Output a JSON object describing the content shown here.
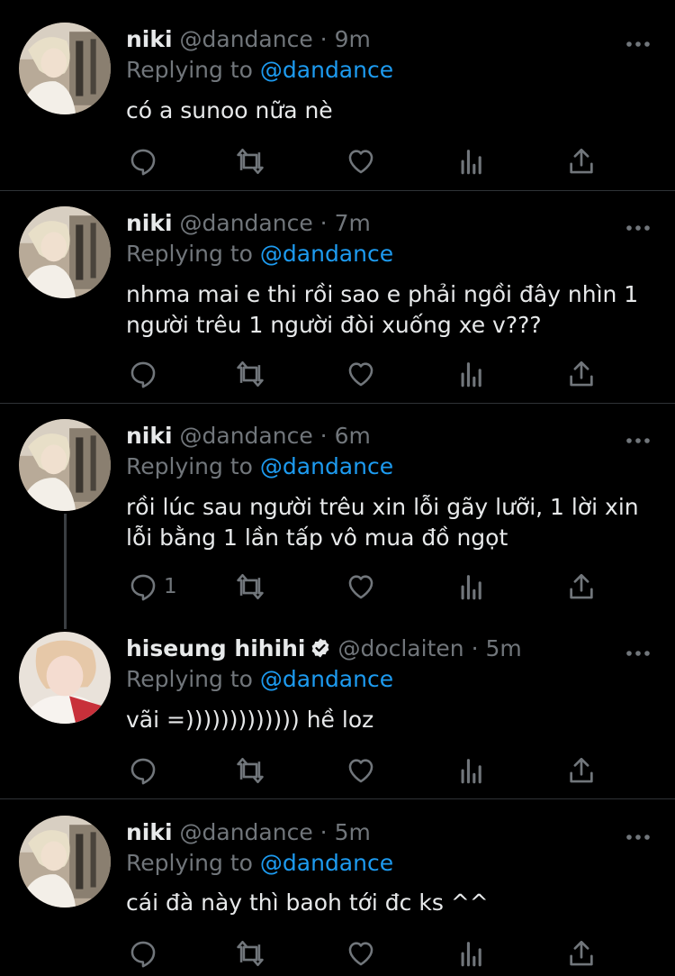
{
  "reply_prefix": "Replying to",
  "tweets": [
    {
      "name": "niki",
      "handle": "@dandance",
      "time": "9m",
      "reply_to": "@dandance",
      "lines": [
        "có a sunoo nữa nè"
      ],
      "reply_count": ""
    },
    {
      "name": "niki",
      "handle": "@dandance",
      "time": "7m",
      "reply_to": "@dandance",
      "lines": [
        "nhma mai e thi rồi sao e phải ngồi đây nhìn 1",
        "người trêu 1 người đòi xuống xe v???"
      ],
      "reply_count": ""
    },
    {
      "name": "niki",
      "handle": "@dandance",
      "time": "6m",
      "reply_to": "@dandance",
      "lines": [
        "rồi lúc sau người trêu xin lỗi gãy lưỡi, 1 lời xin",
        "lỗi bằng 1 lần tấp vô mua đồ ngọt"
      ],
      "reply_count": "1"
    },
    {
      "name": "hiseung hihihi",
      "handle": "@doclaiten",
      "time": "5m",
      "reply_to": "@dandance",
      "lines": [
        "vãi =))))))))))))) hề loz"
      ],
      "reply_count": "",
      "verified": true
    },
    {
      "name": "niki",
      "handle": "@dandance",
      "time": "5m",
      "reply_to": "@dandance",
      "lines": [
        "cái đà này thì baoh tới đc ks ^^"
      ],
      "reply_count": ""
    }
  ],
  "dot": "·",
  "colors": {
    "background": "#000000",
    "accent": "#1d9bf0",
    "muted": "#71767b"
  },
  "icons": [
    "reply-icon",
    "retweet-icon",
    "like-icon",
    "stats-icon",
    "share-icon",
    "more-icon",
    "verified-icon"
  ]
}
